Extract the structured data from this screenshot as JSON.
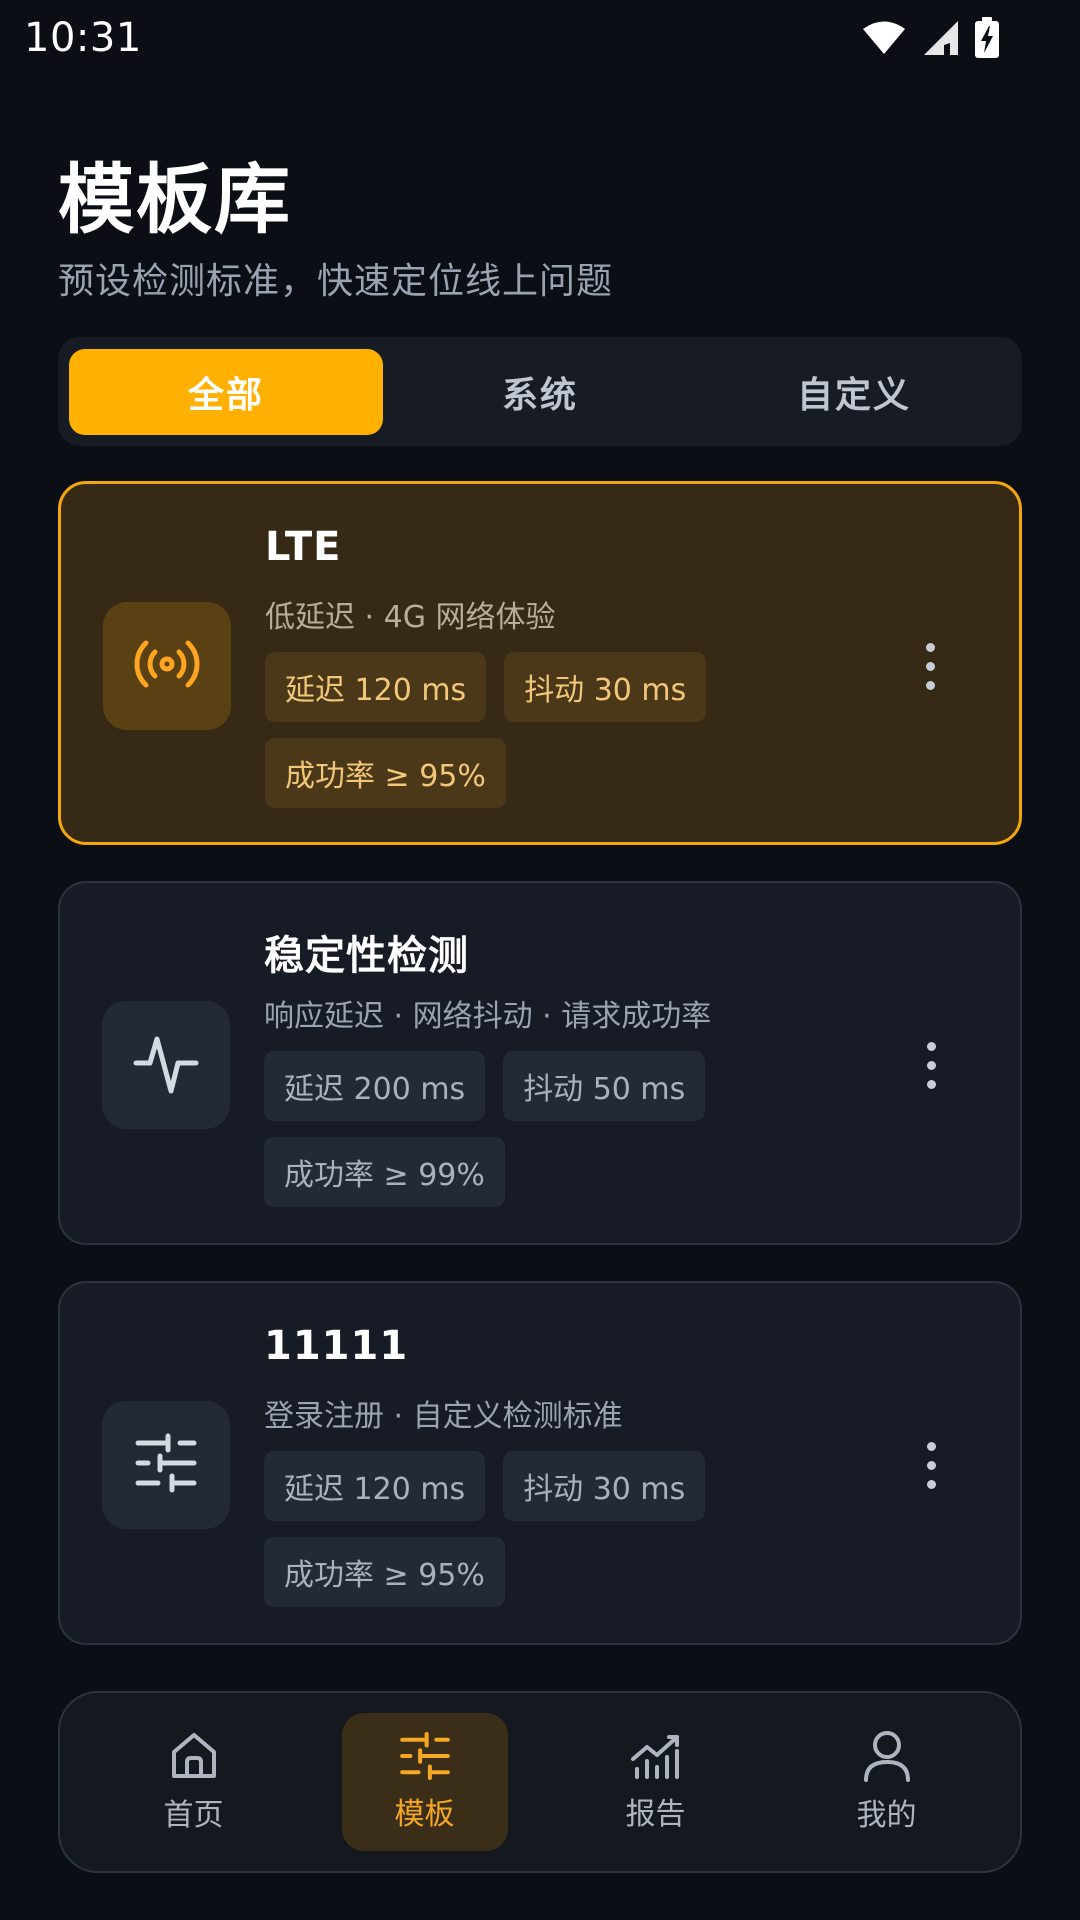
{
  "status_bar": {
    "time": "10:31"
  },
  "header": {
    "title": "模板库",
    "subtitle": "预设检测标准，快速定位线上问题"
  },
  "tabs": [
    {
      "label": "全部",
      "active": true
    },
    {
      "label": "系统",
      "active": false
    },
    {
      "label": "自定义",
      "active": false
    }
  ],
  "templates": [
    {
      "title": "LTE",
      "description": "低延迟 · 4G 网络体验",
      "icon": "broadcast-icon",
      "selected": true,
      "chips": [
        "延迟 120 ms",
        "抖动 30 ms",
        "成功率 ≥ 95%"
      ]
    },
    {
      "title": "稳定性检测",
      "description": "响应延迟 · 网络抖动 · 请求成功率",
      "icon": "pulse-icon",
      "selected": false,
      "chips": [
        "延迟 200 ms",
        "抖动 50 ms",
        "成功率 ≥ 99%"
      ]
    },
    {
      "title": "11111",
      "description": "登录注册 · 自定义检测标准",
      "icon": "sliders-icon",
      "selected": false,
      "chips": [
        "延迟 120 ms",
        "抖动 30 ms",
        "成功率 ≥ 95%"
      ]
    }
  ],
  "bottom_nav": [
    {
      "label": "首页",
      "icon": "home-icon",
      "active": false
    },
    {
      "label": "模板",
      "icon": "sliders-icon",
      "active": true
    },
    {
      "label": "报告",
      "icon": "chart-icon",
      "active": false
    },
    {
      "label": "我的",
      "icon": "user-icon",
      "active": false
    }
  ],
  "colors": {
    "accent": "#ffb000",
    "background": "#0b0f15",
    "card": "#161b26",
    "selected_card": "#362915"
  }
}
